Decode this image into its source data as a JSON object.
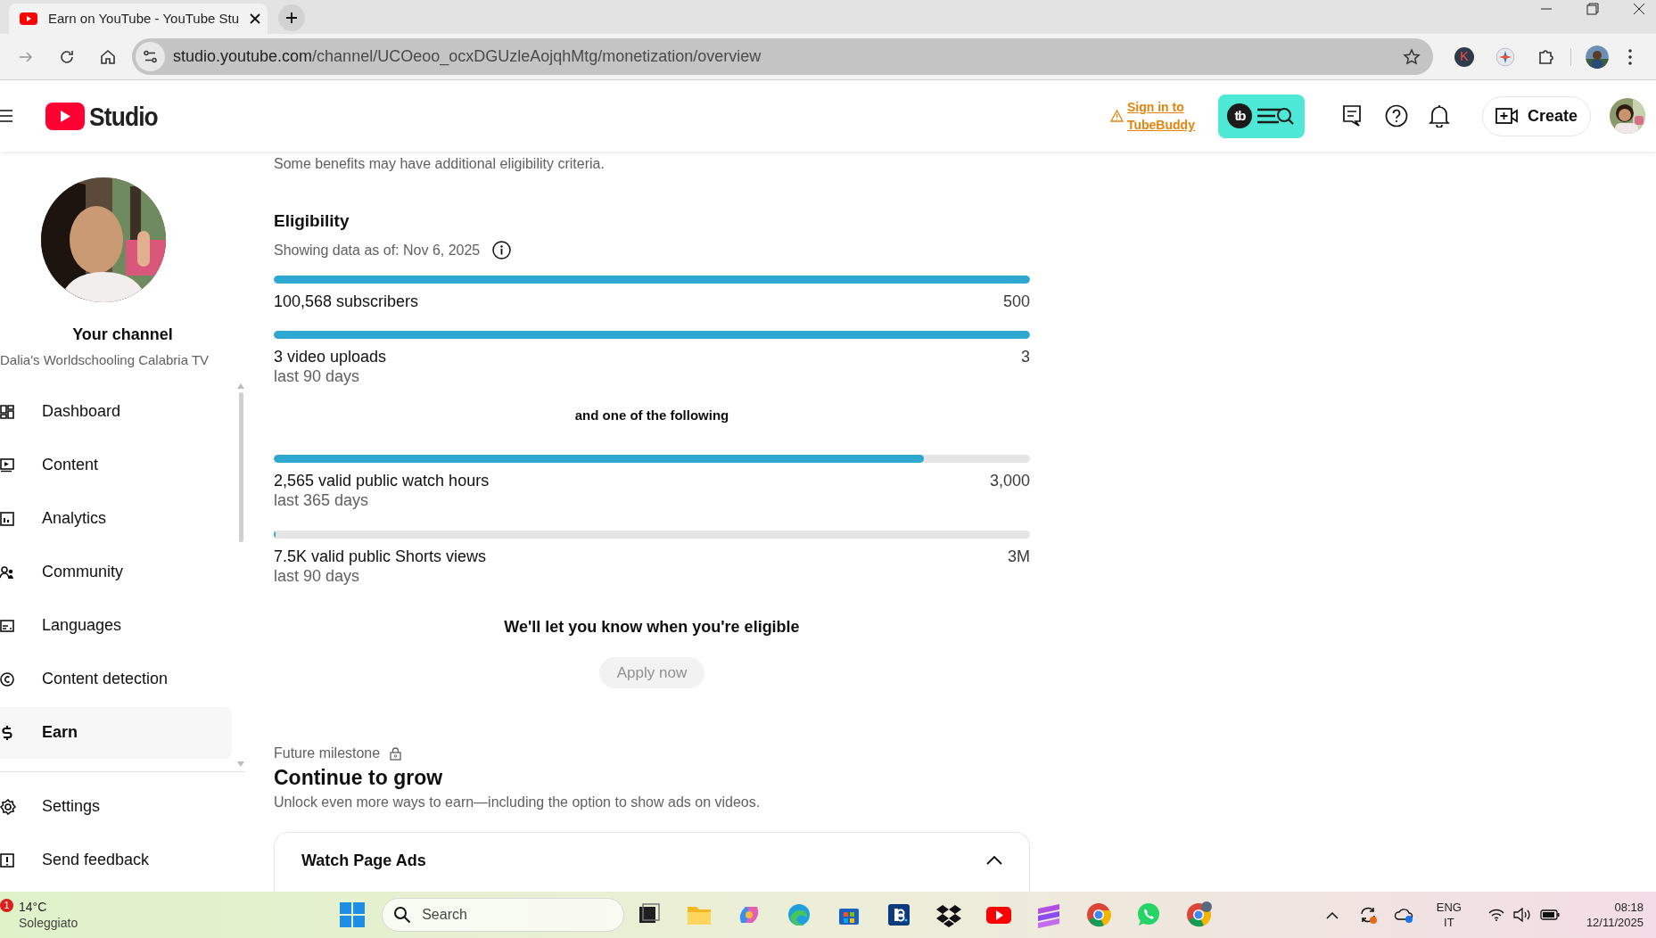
{
  "browser": {
    "tab": {
      "title": "Earn on YouTube - YouTube Stu"
    },
    "address": {
      "host": "studio.youtube.com",
      "path": "/channel/UCOeoo_ocxDGUzleAojqhMtg/monetization/overview"
    },
    "extension_badge": "K"
  },
  "header": {
    "logo": "Studio",
    "tubebuddy_link": "Sign in to TubeBuddy",
    "tubebuddy_badge": "tb",
    "create_button": "Create"
  },
  "sidebar": {
    "channel_heading": "Your channel",
    "channel_name": "Dalia's Worldschooling Calabria TV",
    "items": [
      {
        "label": "Dashboard",
        "selected": false
      },
      {
        "label": "Content",
        "selected": false
      },
      {
        "label": "Analytics",
        "selected": false
      },
      {
        "label": "Community",
        "selected": false
      },
      {
        "label": "Languages",
        "selected": false
      },
      {
        "label": "Content detection",
        "selected": false
      },
      {
        "label": "Earn",
        "selected": true
      }
    ],
    "footer_items": [
      {
        "label": "Settings"
      },
      {
        "label": "Send feedback"
      }
    ]
  },
  "main": {
    "note": "Some benefits may have additional eligibility criteria.",
    "eligibility": {
      "title": "Eligibility",
      "as_of": "Showing data as of: Nov 6, 2025",
      "requirements": [
        {
          "label": "100,568 subscribers",
          "target": "500",
          "level": 1
        },
        {
          "label": "3 video uploads",
          "period": "last 90 days",
          "target": "3",
          "level": 1
        }
      ],
      "alternatives_heading": "and one of the following",
      "alternatives": [
        {
          "label": "2,565 valid public watch hours",
          "period": "last 365 days",
          "target": "3,000",
          "level": 0.86
        },
        {
          "label": "7.5K valid public Shorts views",
          "period": "last 90 days",
          "target": "3M",
          "level": 0.0025
        }
      ],
      "status": "We'll let you know when you're eligible",
      "apply_button": {
        "label": "Apply now",
        "disabled": true
      }
    },
    "milestone": {
      "kicker": "Future milestone",
      "title": "Continue to grow",
      "description": "Unlock even more ways to earn—including the option to show ads on videos.",
      "card": {
        "title": "Watch Page Ads",
        "expanded": true
      }
    }
  },
  "taskbar": {
    "weather": {
      "temperature": "14°C",
      "condition": "Soleggiato",
      "badge": "1"
    },
    "search": {
      "placeholder": "Search"
    },
    "language": {
      "primary": "ENG",
      "secondary": "IT"
    },
    "clock": {
      "time": "08:18",
      "date": "12/11/2025"
    }
  }
}
